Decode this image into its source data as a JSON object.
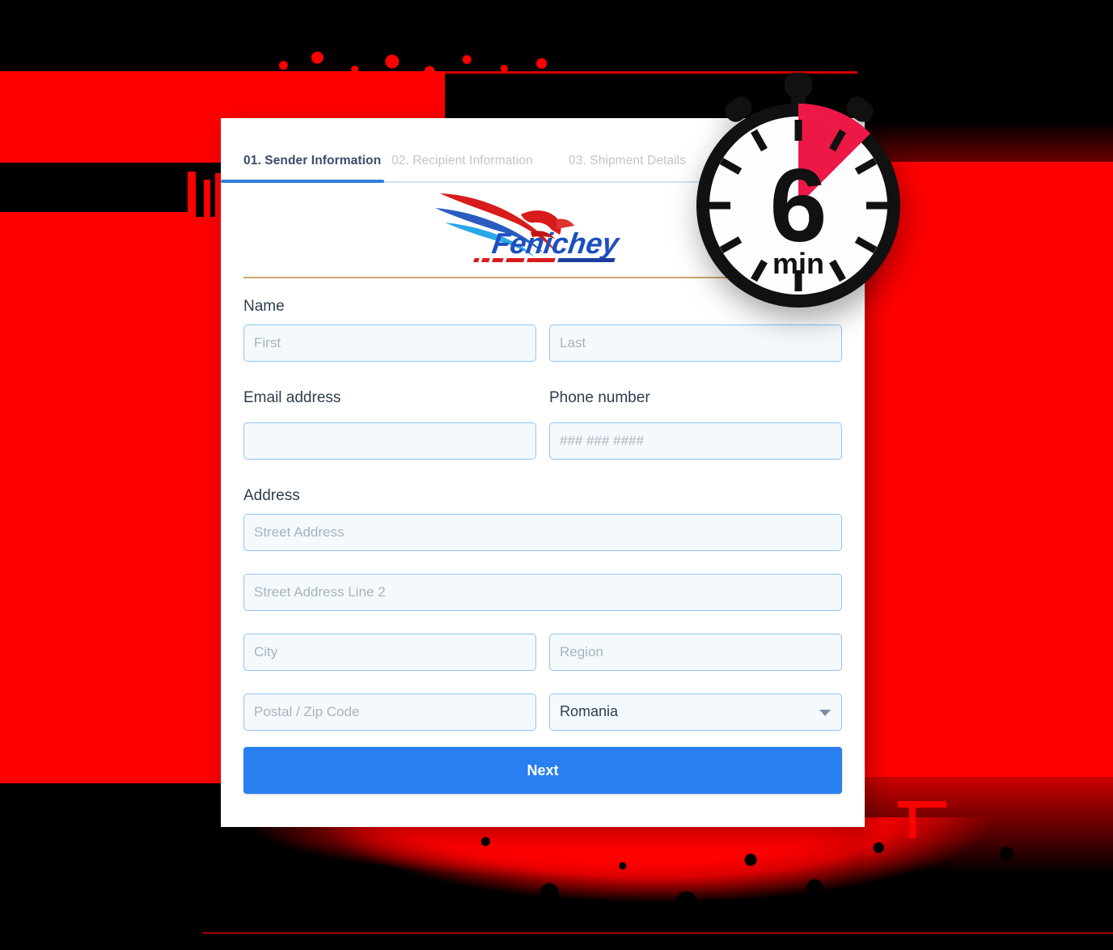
{
  "theme": {
    "page_bg": "#000000",
    "splatter_color": "#FF0000",
    "card_bg": "#FFFFFF",
    "accent_blue": "#2A7FF0",
    "tab_active_color": "#3B4A6B",
    "tab_inactive_color": "#C0C4CB",
    "input_border": "#8FC4F2",
    "input_bg": "#F4F9FE",
    "gold_rule": "#C9A86A",
    "stopwatch_wedge": "#ED1846",
    "stopwatch_body": "#111111"
  },
  "form": {
    "tabs": [
      {
        "label": "01. Sender Information",
        "active": true
      },
      {
        "label": "02. Recipient Information",
        "active": false
      },
      {
        "label": "03. Shipment Details",
        "active": false
      }
    ],
    "brand": {
      "name": "Fenichey",
      "icon": "eagle-logo"
    },
    "sections": {
      "name": {
        "label": "Name",
        "first": {
          "placeholder": "First",
          "value": ""
        },
        "last": {
          "placeholder": "Last",
          "value": ""
        }
      },
      "email": {
        "label": "Email address",
        "placeholder": "",
        "value": ""
      },
      "phone": {
        "label": "Phone number",
        "placeholder": "### ### ####",
        "value": ""
      },
      "address": {
        "label": "Address",
        "street1": {
          "placeholder": "Street Address",
          "value": ""
        },
        "street2": {
          "placeholder": "Street Address Line 2",
          "value": ""
        },
        "city": {
          "placeholder": "City",
          "value": ""
        },
        "region": {
          "placeholder": "Region",
          "value": ""
        },
        "postal": {
          "placeholder": "Postal / Zip Code",
          "value": ""
        },
        "country": {
          "selected": "Romania"
        }
      }
    },
    "submit": {
      "label": "Next"
    }
  },
  "badge": {
    "type": "stopwatch",
    "number": "6",
    "unit": "min"
  }
}
